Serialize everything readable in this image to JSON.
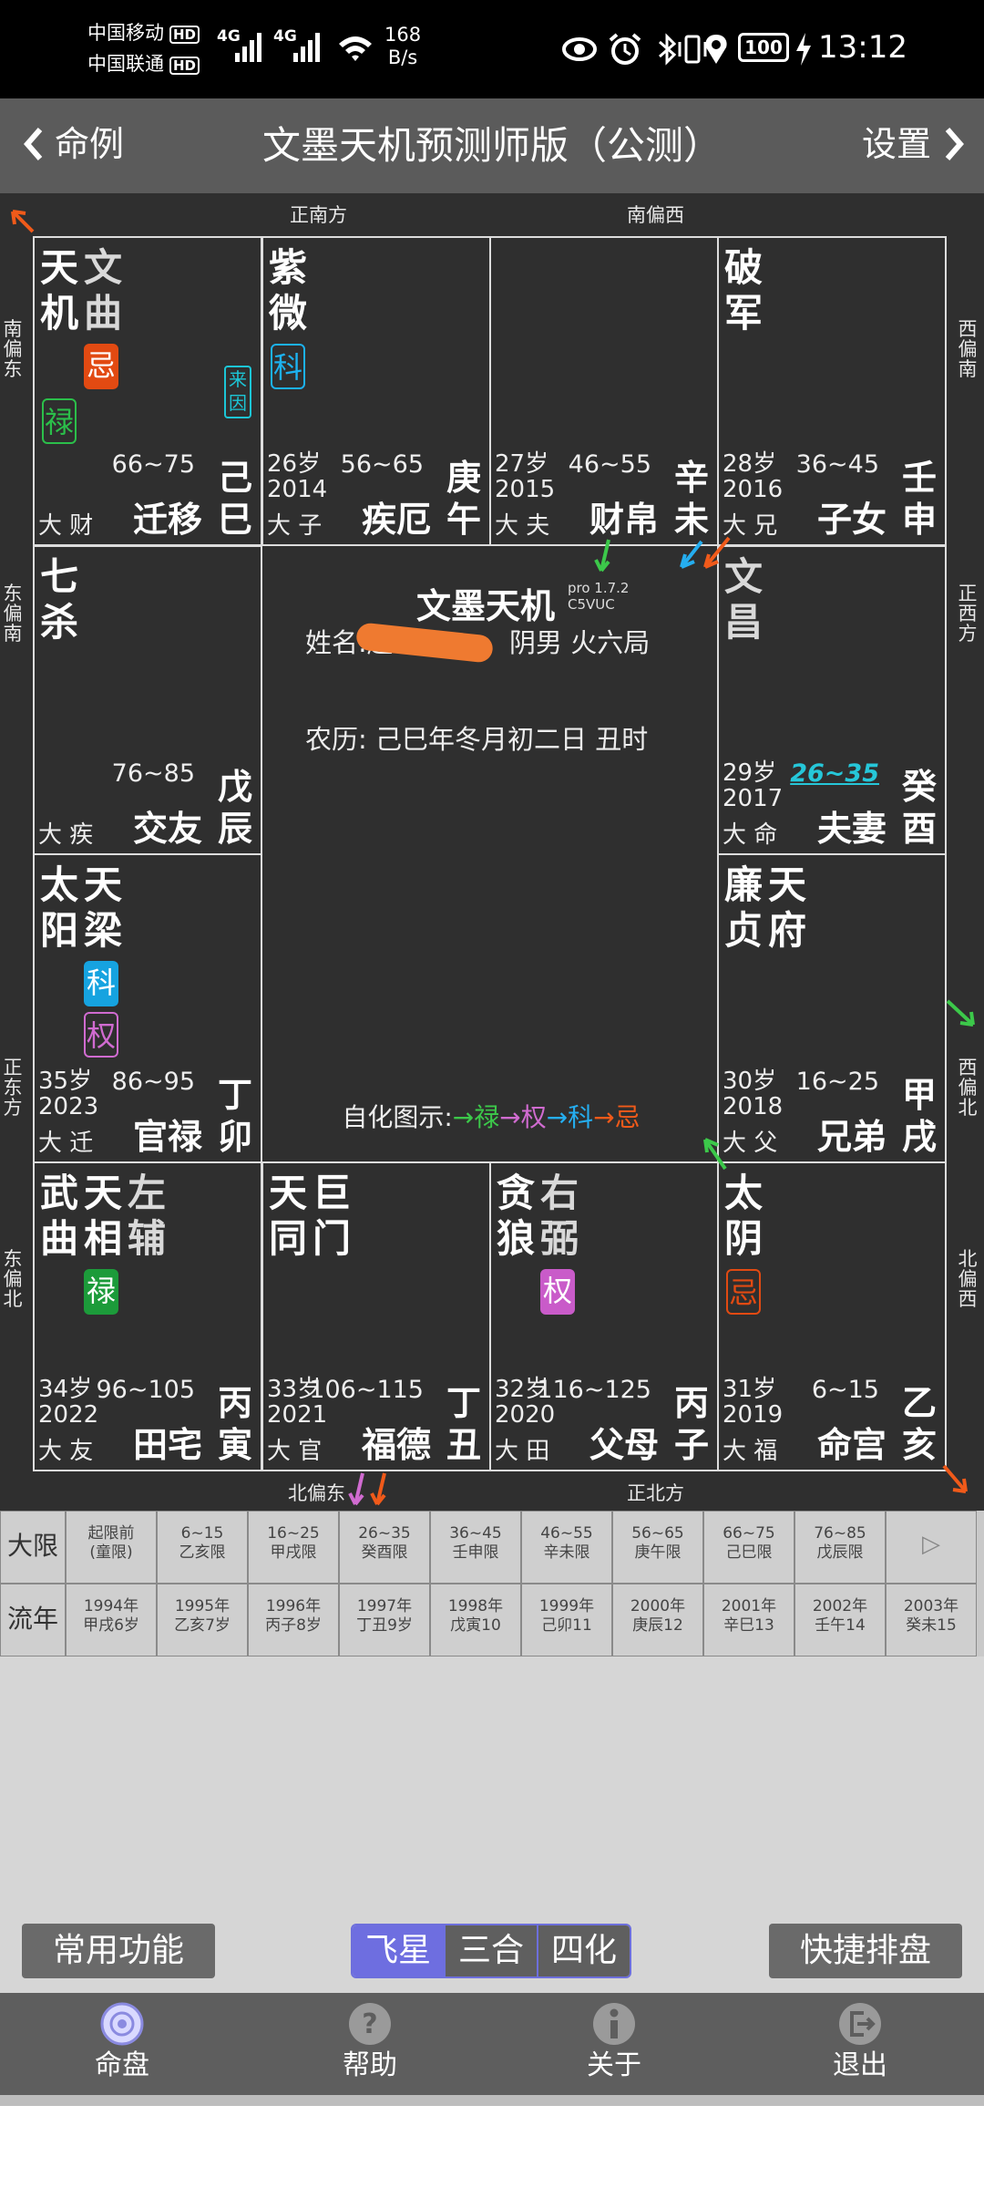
{
  "status": {
    "carrier1": "中国移动",
    "carrier2": "中国联通",
    "hd": "HD",
    "net": "4G",
    "speed_value": "168",
    "speed_unit": "B/s",
    "battery": "100",
    "time": "13:12"
  },
  "titlebar": {
    "back": "命例",
    "title": "文墨天机预测师版（公测）",
    "settings": "设置"
  },
  "directions": {
    "top": [
      "正南方",
      "南偏西"
    ],
    "bottom": [
      "北偏东",
      "正北方"
    ],
    "left": [
      "南偏东",
      "东偏南",
      "正东方",
      "东偏北"
    ],
    "right": [
      "西偏南",
      "正西方",
      "西偏北",
      "北偏西"
    ]
  },
  "palaces": [
    {
      "stars": [
        [
          "天",
          "机"
        ],
        [
          "文",
          "曲"
        ]
      ],
      "minor": [
        false,
        true
      ],
      "badges": [
        {
          "t": "忌",
          "c": "b-ji"
        },
        {
          "t": "禄",
          "c": "b-o-lu"
        }
      ],
      "laiyin": "来因",
      "age": "",
      "year": "",
      "dx": "大 财",
      "range": "66~75",
      "name": "迁移",
      "gz": [
        "己",
        "巳"
      ]
    },
    {
      "stars": [
        [
          "紫",
          "微"
        ]
      ],
      "minor": [
        false
      ],
      "badges": [
        {
          "t": "科",
          "c": "b-o-ke"
        }
      ],
      "age": "26岁",
      "year": "2014",
      "dx": "大 子",
      "range": "56~65",
      "name": "疾厄",
      "gz": [
        "庚",
        "午"
      ]
    },
    {
      "stars": [],
      "minor": [],
      "badges": [],
      "age": "27岁",
      "year": "2015",
      "dx": "大 夫",
      "range": "46~55",
      "name": "财帛",
      "gz": [
        "辛",
        "未"
      ]
    },
    {
      "stars": [
        [
          "破",
          "军"
        ]
      ],
      "minor": [
        false
      ],
      "badges": [],
      "age": "28岁",
      "year": "2016",
      "dx": "大 兄",
      "range": "36~45",
      "name": "子女",
      "gz": [
        "壬",
        "申"
      ]
    },
    {
      "stars": [
        [
          "七",
          "杀"
        ]
      ],
      "minor": [
        false
      ],
      "badges": [],
      "age": "",
      "year": "",
      "dx": "大 疾",
      "range": "76~85",
      "name": "交友",
      "gz": [
        "戊",
        "辰"
      ]
    },
    {
      "stars": [
        [
          "文",
          "昌"
        ]
      ],
      "minor": [
        true
      ],
      "badges": [],
      "age": "29岁",
      "year": "2017",
      "dx": "大 命",
      "range": "26~35",
      "name": "夫妻",
      "gz": [
        "癸",
        "酉"
      ],
      "current": true
    },
    {
      "stars": [
        [
          "太",
          "阳"
        ],
        [
          "天",
          "梁"
        ]
      ],
      "minor": [
        false,
        false
      ],
      "badges": [
        {
          "t": "科",
          "c": "b-ke"
        },
        {
          "t": "权",
          "c": "b-o-quan"
        }
      ],
      "age": "35岁",
      "year": "2023",
      "dx": "大 迁",
      "range": "86~95",
      "name": "官禄",
      "gz": [
        "丁",
        "卯"
      ]
    },
    {
      "stars": [
        [
          "廉",
          "贞"
        ],
        [
          "天",
          "府"
        ]
      ],
      "minor": [
        false,
        false
      ],
      "badges": [],
      "age": "30岁",
      "year": "2018",
      "dx": "大 父",
      "range": "16~25",
      "name": "兄弟",
      "gz": [
        "甲",
        "戌"
      ]
    },
    {
      "stars": [
        [
          "武",
          "曲"
        ],
        [
          "天",
          "相"
        ],
        [
          "左",
          "辅"
        ]
      ],
      "minor": [
        false,
        false,
        true
      ],
      "badges": [
        {
          "t": "禄",
          "c": "b-lu"
        }
      ],
      "age": "34岁",
      "year": "2022",
      "dx": "大 友",
      "range": "96~105",
      "name": "田宅",
      "gz": [
        "丙",
        "寅"
      ]
    },
    {
      "stars": [
        [
          "天",
          "同"
        ],
        [
          "巨",
          "门"
        ]
      ],
      "minor": [
        false,
        false
      ],
      "badges": [],
      "age": "33岁",
      "year": "2021",
      "dx": "大 官",
      "range": "106~115",
      "name": "福德",
      "gz": [
        "丁",
        "丑"
      ]
    },
    {
      "stars": [
        [
          "贪",
          "狼"
        ],
        [
          "右",
          "弼"
        ]
      ],
      "minor": [
        false,
        true
      ],
      "badges": [
        {
          "t": "权",
          "c": "b-quan"
        }
      ],
      "age": "32岁",
      "year": "2020",
      "dx": "大 田",
      "range": "116~125",
      "name": "父母",
      "gz": [
        "丙",
        "子"
      ]
    },
    {
      "stars": [
        [
          "太",
          "阴"
        ]
      ],
      "minor": [
        false
      ],
      "badges": [
        {
          "t": "忌",
          "c": "b-o-ji"
        }
      ],
      "age": "31岁",
      "year": "2019",
      "dx": "大 福",
      "range": "6~15",
      "name": "命宫",
      "gz": [
        "乙",
        "亥"
      ]
    }
  ],
  "center": {
    "brand": "文墨天机",
    "version": "pro 1.7.2",
    "code": "C5VUC",
    "name_label": "姓名:",
    "name_visible": "赵",
    "gender_ju": "阴男 火六局",
    "lunar": "农历: 己巳年冬月初二日 丑时",
    "legend_label": "自化图示:",
    "legend": [
      {
        "t": "→禄",
        "c": "#3cc84a"
      },
      {
        "t": "→权",
        "c": "#d06bd0"
      },
      {
        "t": "→科",
        "c": "#25aef0"
      },
      {
        "t": "→忌",
        "c": "#f05a1a"
      }
    ]
  },
  "daxian": {
    "label": "大限",
    "cells": [
      [
        "起限前",
        "(童限)"
      ],
      [
        "6~15",
        "乙亥限"
      ],
      [
        "16~25",
        "甲戌限"
      ],
      [
        "26~35",
        "癸酉限"
      ],
      [
        "36~45",
        "壬申限"
      ],
      [
        "46~55",
        "辛未限"
      ],
      [
        "56~65",
        "庚午限"
      ],
      [
        "66~75",
        "己巳限"
      ],
      [
        "76~85",
        "戊辰限"
      ],
      [
        "▷",
        ""
      ]
    ]
  },
  "liunian": {
    "label": "流年",
    "cells": [
      [
        "1994年",
        "甲戌6岁"
      ],
      [
        "1995年",
        "乙亥7岁"
      ],
      [
        "1996年",
        "丙子8岁"
      ],
      [
        "1997年",
        "丁丑9岁"
      ],
      [
        "1998年",
        "戊寅10"
      ],
      [
        "1999年",
        "己卯11"
      ],
      [
        "2000年",
        "庚辰12"
      ],
      [
        "2001年",
        "辛巳13"
      ],
      [
        "2002年",
        "壬午14"
      ],
      [
        "2003年",
        "癸未15"
      ]
    ]
  },
  "buttons": {
    "common": "常用功能",
    "quick": "快捷排盘",
    "segments": [
      "飞星",
      "三合",
      "四化"
    ]
  },
  "nav": [
    "命盘",
    "帮助",
    "关于",
    "退出"
  ],
  "colors": {
    "accent": "#6e6ee0",
    "ji": "#e24a12",
    "lu": "#1c9b3a",
    "ke": "#16a3e0",
    "quan": "#c95bc9",
    "cur_range": "#26c7d9"
  }
}
